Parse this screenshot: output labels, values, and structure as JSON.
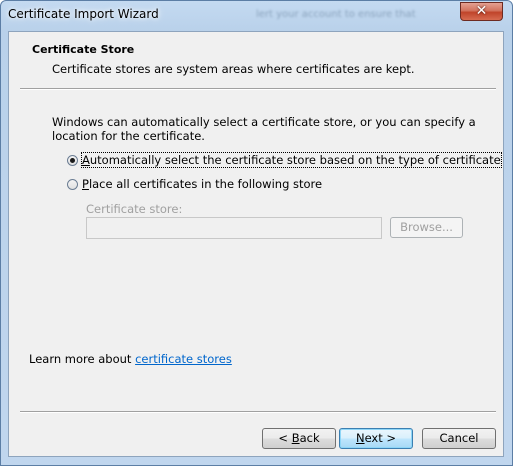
{
  "window": {
    "title": "Certificate Import Wizard",
    "background_title_text": "lert your account to ensure that",
    "close_glyph": "✕"
  },
  "header": {
    "title": "Certificate Store",
    "description": "Certificate stores are system areas where certificates are kept."
  },
  "body": {
    "info": "Windows can automatically select a certificate store, or you can specify a location for the certificate.",
    "options": [
      {
        "mnemonic": "A",
        "rest": "utomatically select the certificate store based on the type of certificate",
        "checked": true
      },
      {
        "mnemonic": "P",
        "rest": "lace all certificates in the following store",
        "checked": false
      }
    ],
    "store_label": "Certificate store:",
    "store_value": "",
    "browse_label": "Browse...",
    "learn_prefix": "Learn more about ",
    "learn_link": "certificate stores"
  },
  "footer": {
    "back_prefix": "< ",
    "back_mnemonic": "B",
    "back_rest": "ack",
    "next_mnemonic": "N",
    "next_rest": "ext >",
    "cancel_label": "Cancel"
  },
  "colors": {
    "link": "#0066cc",
    "close_button": "#c0442a",
    "frame": "#b9d1ea"
  }
}
